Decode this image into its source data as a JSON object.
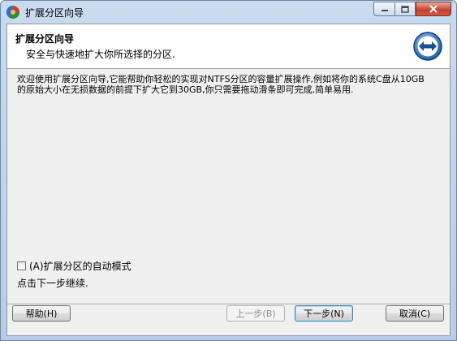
{
  "window": {
    "title": "扩展分区向导"
  },
  "header": {
    "title": "扩展分区向导",
    "subtitle": "安全与快速地扩大你所选择的分区."
  },
  "content": {
    "description": "欢迎使用扩展分区向导,它能帮助你轻松的实现对NTFS分区的容量扩展操作,例如将你的系统C盘从10GB的原始大小在无损数据的前提下扩大它到30GB,你只需要拖动滑条即可完成,简单易用.",
    "auto_mode_label": "(A)扩展分区的自动模式",
    "auto_mode_checked": false,
    "hint": "点击下一步继续."
  },
  "buttons": {
    "help": "帮助(H)",
    "back": "上一步(B)",
    "next": "下一步(N)",
    "cancel": "取消(C)"
  },
  "icons": {
    "app": "partition-tool-icon",
    "header": "expand-arrows-icon",
    "minimize": "minimize-icon",
    "maximize": "maximize-icon",
    "close": "close-icon"
  }
}
